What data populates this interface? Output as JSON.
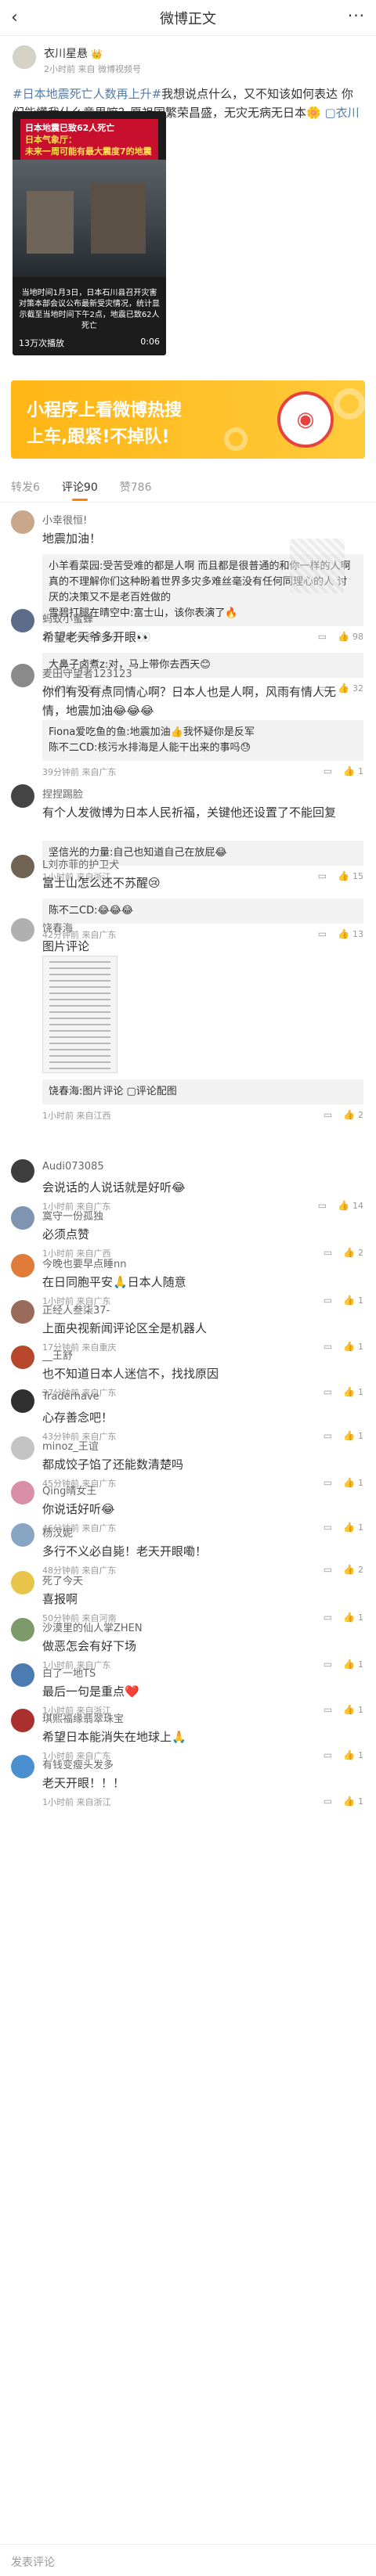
{
  "header": {
    "back_icon": "back-arrow-icon",
    "title": "微博正文",
    "more_icon": "more-dots-icon"
  },
  "post": {
    "author": "衣川星悬",
    "vip_badge": "👑",
    "meta": "2小时前 来自 微博视频号",
    "text_tag": "#日本地震死亡人数再上升#",
    "text_body": "我想说点什么，又不知该如何表达 你们能懂我什么意思嘛？愿祖国繁荣昌盛，无灾无病无日本",
    "text_emoji": "🌼",
    "link_text": "衣川星悬的微博视频"
  },
  "video": {
    "headline_1": "日本地震已致62人死亡",
    "headline_2": "日本气象厅：",
    "headline_3": "未来一周可能有最大震度7的地震",
    "caption": "当地时间1月3日，日本石川县召开灾害对策本部会议公布最新受灾情况，统计显示截至当地时间下午2点，地震已致62人死亡",
    "plays": "13万次播放",
    "duration": "0:06"
  },
  "banner": {
    "line1": "小程序上看微博热搜",
    "line2": "上车,跟紧!不掉队!"
  },
  "tabs": [
    {
      "label": "转发6"
    },
    {
      "label": "评论90"
    },
    {
      "label": "赞786"
    }
  ],
  "comments": [
    {
      "name": "小幸很恒!",
      "text": "地震加油！",
      "reply_lines": [
        "小羊看菜园:受苦受难的都是人啊 而且都是很普通的和你一样的人啊 真的不理解你们这种盼着世界多灾多难丝毫没有任何同理心的人 讨厌的决策又不是老百姓做的",
        "雪碧打腿在晴空中:富士山，该你表演了🔥"
      ],
      "meta": "1小时前 来自黑龙江",
      "likes": "98"
    },
    {
      "name": "蚂蚁小蜜蜂",
      "text": "希望老天爷多开眼👀",
      "reply_lines": [
        "大鼻子卤煮z:对，马上带你去西天😊"
      ],
      "meta": "1小时前 来自天津",
      "likes": "32"
    },
    {
      "name": "麦田守望者123123",
      "text": "你们有没有点同情心啊？日本人也是人啊，风雨有情人无情，地震加油😂😂😂",
      "reply_lines": [
        "Fiona爱吃鱼的鱼:地震加油👍我怀疑你是反军",
        "陈不二CD:核污水排海是人能干出来的事吗😓"
      ],
      "meta": "39分钟前 来自广东",
      "likes": "1"
    },
    {
      "name": "捏捏踢脸",
      "text": "有个人发微博为日本人民祈福，关键他还设置了不能回复",
      "reply_lines": [
        "坚信光的力量:自己也知道自己在放屁😂"
      ],
      "meta": "1小时前 来自浙江",
      "likes": "15"
    },
    {
      "name": "L刘亦菲的护卫犬",
      "text": "富士山怎么还不苏醒😢",
      "reply_lines": [
        "陈不二CD:😂😂😂"
      ],
      "meta": "42分钟前 来自广东",
      "likes": "13"
    },
    {
      "name": "饶春海",
      "text": "图片评论",
      "reply_lines": [
        "饶春海:图片评论 ▢评论配图"
      ],
      "meta": "1小时前 来自江西",
      "likes": "2"
    },
    {
      "name": "Audi073085",
      "text": "会说话的人说话就是好听😂",
      "reply_lines": [],
      "meta": "1小时前 来自广东",
      "likes": "14"
    },
    {
      "name": "寞守一份孤独",
      "text": "必须点赞",
      "reply_lines": [],
      "meta": "1小时前 来自广西",
      "likes": "2"
    },
    {
      "name": "今晚也要早点睡nn",
      "text": "在日同胞平安🙏日本人随意",
      "reply_lines": [],
      "meta": "1小时前 来自广东",
      "likes": "1"
    },
    {
      "name": "正经人叁柒37-",
      "text": "上面央视新闻评论区全是机器人",
      "reply_lines": [],
      "meta": "17分钟前 来自重庆",
      "likes": "1"
    },
    {
      "name": "__王舒",
      "text": "也不知道日本人迷信不，找找原因",
      "reply_lines": [],
      "meta": "37分钟前 来自广东",
      "likes": "1"
    },
    {
      "name": "Traderhave",
      "text": "心存善念吧！",
      "reply_lines": [],
      "meta": "43分钟前 来自广东",
      "likes": "1"
    },
    {
      "name": "minoz_王谊",
      "text": "都成饺子馅了还能数清楚吗",
      "reply_lines": [],
      "meta": "45分钟前 来自广东",
      "likes": "1"
    },
    {
      "name": "Qing晴女王",
      "text": "你说话好听😂",
      "reply_lines": [],
      "meta": "46分钟前 来自广东",
      "likes": "1"
    },
    {
      "name": "杨汉妮",
      "text": "多行不义必自毙！老天开眼嘞！",
      "reply_lines": [],
      "meta": "48分钟前 来自广东",
      "likes": "2"
    },
    {
      "name": "死了今天",
      "text": "喜报啊",
      "reply_lines": [],
      "meta": "50分钟前 来自河南",
      "likes": "1"
    },
    {
      "name": "沙漠里的仙人掌ZHEN",
      "text": "做恶怎会有好下场",
      "reply_lines": [],
      "meta": "1小时前 来自广东",
      "likes": "1"
    },
    {
      "name": "白了一地TS",
      "text": "最后一句是重点❤️",
      "reply_lines": [],
      "meta": "1小时前 来自浙江",
      "likes": "1"
    },
    {
      "name": "琪熙福缘翡翠珠宝",
      "text": "希望日本能消失在地球上🙏",
      "reply_lines": [],
      "meta": "1小时前 来自广东",
      "likes": "1"
    },
    {
      "name": "有钱变瘦头发多",
      "text": "老天开眼！！！",
      "reply_lines": [],
      "meta": "1小时前 来自浙江",
      "likes": "1"
    }
  ],
  "footer": {
    "placeholder": "发表评论"
  },
  "icons": {
    "comment": "comment-icon",
    "like": "like-icon"
  }
}
